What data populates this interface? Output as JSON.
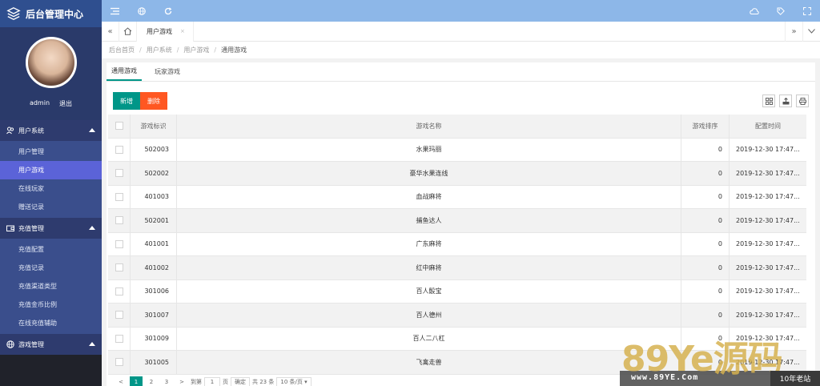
{
  "app": {
    "title": "后台管理中心"
  },
  "profile": {
    "username": "admin",
    "logout": "退出"
  },
  "sidebar": {
    "groups": [
      {
        "title": "用户系统",
        "icon": "users-icon",
        "items": [
          {
            "label": "用户管理",
            "active": false
          },
          {
            "label": "用户游戏",
            "active": true
          },
          {
            "label": "在线玩家",
            "active": false
          },
          {
            "label": "赠送记录",
            "active": false
          }
        ]
      },
      {
        "title": "充值管理",
        "icon": "wallet-icon",
        "items": [
          {
            "label": "充值配置",
            "active": false
          },
          {
            "label": "充值记录",
            "active": false
          },
          {
            "label": "充值渠道类型",
            "active": false
          },
          {
            "label": "充值金币比例",
            "active": false
          },
          {
            "label": "在线充值辅助",
            "active": false
          }
        ]
      },
      {
        "title": "游戏管理",
        "icon": "globe-icon",
        "items": []
      }
    ]
  },
  "topbar": {
    "left_icons": [
      "menu-icon",
      "globe-icon",
      "refresh-icon"
    ],
    "right_icons": [
      "cloud-icon",
      "tag-icon",
      "fullscreen-icon"
    ]
  },
  "tabbar": {
    "active_tab": "用户游戏",
    "close": "×"
  },
  "breadcrumb": [
    "后台首页",
    "用户系统",
    "用户游戏",
    "通用游戏"
  ],
  "subtabs": [
    "通用游戏",
    "玩家游戏"
  ],
  "toolbar": {
    "add": "新增",
    "delete": "删除"
  },
  "table": {
    "headers": {
      "id": "游戏标识",
      "name": "游戏名称",
      "sort": "游戏排序",
      "time": "配置时间"
    },
    "rows": [
      {
        "id": "502003",
        "name": "水果玛丽",
        "sort": "0",
        "time": "2019-12-30 17:47..."
      },
      {
        "id": "502002",
        "name": "豪华水果连线",
        "sort": "0",
        "time": "2019-12-30 17:47..."
      },
      {
        "id": "401003",
        "name": "血战麻将",
        "sort": "0",
        "time": "2019-12-30 17:47..."
      },
      {
        "id": "502001",
        "name": "捕鱼达人",
        "sort": "0",
        "time": "2019-12-30 17:47..."
      },
      {
        "id": "401001",
        "name": "广东麻将",
        "sort": "0",
        "time": "2019-12-30 17:47..."
      },
      {
        "id": "401002",
        "name": "红中麻将",
        "sort": "0",
        "time": "2019-12-30 17:47..."
      },
      {
        "id": "301006",
        "name": "百人骰宝",
        "sort": "0",
        "time": "2019-12-30 17:47..."
      },
      {
        "id": "301007",
        "name": "百人德州",
        "sort": "0",
        "time": "2019-12-30 17:47..."
      },
      {
        "id": "301009",
        "name": "百人二八杠",
        "sort": "0",
        "time": "2019-12-30 17:47..."
      },
      {
        "id": "301005",
        "name": "飞禽走兽",
        "sort": "0",
        "time": "2019-12-30 17:47..."
      }
    ]
  },
  "pager": {
    "prev": "<",
    "pages": [
      "1",
      "2",
      "3"
    ],
    "next": ">",
    "goto": "到第",
    "page_value": "1",
    "page_unit": "页",
    "confirm": "确定",
    "total": "共 23 条",
    "per_page": "10 条/页"
  },
  "watermark": {
    "brand": "89Ye源码",
    "url": "www.89YE.Com",
    "tag": "10年老站"
  }
}
